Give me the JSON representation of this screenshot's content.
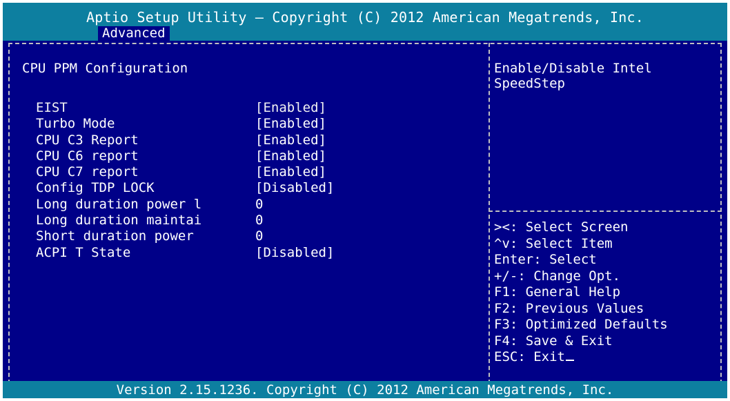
{
  "header": {
    "title": "Aptio Setup Utility – Copyright (C) 2012 American Megatrends, Inc.",
    "active_tab": "Advanced"
  },
  "main": {
    "section_title": "CPU PPM Configuration",
    "settings": [
      {
        "label": "EIST",
        "value": "[Enabled]"
      },
      {
        "label": "Turbo Mode",
        "value": "[Enabled]"
      },
      {
        "label": "CPU C3 Report",
        "value": "[Enabled]"
      },
      {
        "label": "CPU C6 report",
        "value": "[Enabled]"
      },
      {
        "label": "CPU C7 report",
        "value": "[Enabled]"
      },
      {
        "label": "Config TDP LOCK",
        "value": "[Disabled]"
      },
      {
        "label": "Long duration power l",
        "value": "0"
      },
      {
        "label": "Long duration maintai",
        "value": "0"
      },
      {
        "label": "Short duration power",
        "value": "0"
      },
      {
        "label": "ACPI T State",
        "value": "[Disabled]"
      }
    ]
  },
  "help_panel": {
    "line1": "Enable/Disable Intel",
    "line2": "SpeedStep"
  },
  "keys": [
    "><: Select Screen",
    "^v: Select Item",
    "Enter: Select",
    "+/-: Change Opt.",
    "F1: General Help",
    "F2: Previous Values",
    "F3: Optimized Defaults",
    "F4: Save & Exit",
    "ESC: Exit"
  ],
  "footer": {
    "version": "Version 2.15.1236. Copyright (C) 2012 American Megatrends, Inc."
  },
  "colors": {
    "background": "#000088",
    "bar": "#0d7fa0",
    "text": "#ffffff",
    "border": "#c0c0c0"
  }
}
